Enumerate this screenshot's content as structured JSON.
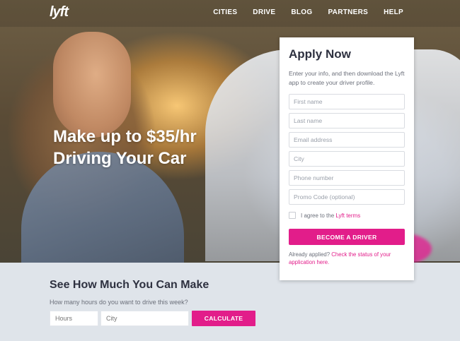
{
  "brand": {
    "logo_text": "lyft",
    "accent_color": "#e21d8a"
  },
  "nav": {
    "items": [
      "CITIES",
      "DRIVE",
      "BLOG",
      "PARTNERS",
      "HELP"
    ]
  },
  "hero": {
    "headline_line1": "Make up to $35/hr",
    "headline_line2": "Driving Your Car"
  },
  "apply": {
    "title": "Apply Now",
    "description": "Enter your info, and then download the Lyft app to create your driver profile.",
    "fields": {
      "first_name": "First name",
      "last_name": "Last name",
      "email": "Email address",
      "city": "City",
      "phone": "Phone number",
      "promo": "Promo Code (optional)"
    },
    "agree_prefix": "I agree to the ",
    "agree_link": "Lyft terms",
    "button_label": "BECOME A DRIVER",
    "already_prefix": "Already applied? ",
    "already_link": "Check the status of your application here."
  },
  "calculator": {
    "title": "See How Much You Can Make",
    "question": "How many hours do you want to drive this week?",
    "hours_placeholder": "Hours",
    "city_placeholder": "City",
    "button_label": "CALCULATE"
  }
}
